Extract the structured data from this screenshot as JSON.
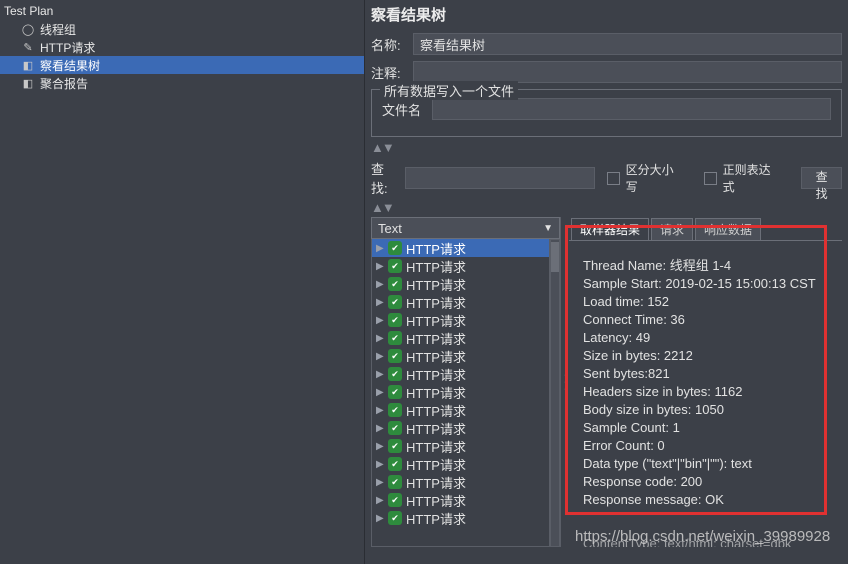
{
  "tree": {
    "root": "Test Plan",
    "items": [
      {
        "label": "线程组",
        "icon": "thread-group"
      },
      {
        "label": "HTTP请求",
        "icon": "sampler"
      },
      {
        "label": "察看结果树",
        "icon": "listener",
        "selected": true
      },
      {
        "label": "聚合报告",
        "icon": "listener"
      }
    ]
  },
  "panel": {
    "title": "察看结果树",
    "name_label": "名称:",
    "name_value": "察看结果树",
    "comment_label": "注释:",
    "fieldset_title": "所有数据写入一个文件",
    "file_label": "文件名"
  },
  "search": {
    "label": "查找:",
    "value": "",
    "case_label": "区分大小写",
    "regex_label": "正则表达式",
    "btn": "查找"
  },
  "render_dropdown": "Text",
  "tabs": [
    "取样器结果",
    "请求",
    "响应数据"
  ],
  "results": [
    "HTTP请求",
    "HTTP请求",
    "HTTP请求",
    "HTTP请求",
    "HTTP请求",
    "HTTP请求",
    "HTTP请求",
    "HTTP请求",
    "HTTP请求",
    "HTTP请求",
    "HTTP请求",
    "HTTP请求",
    "HTTP请求",
    "HTTP请求",
    "HTTP请求",
    "HTTP请求"
  ],
  "details": [
    "Thread Name: 线程组 1-4",
    "Sample Start: 2019-02-15 15:00:13 CST",
    "Load time: 152",
    "Connect Time: 36",
    "Latency: 49",
    "Size in bytes: 2212",
    "Sent bytes:821",
    "Headers size in bytes: 1162",
    "Body size in bytes: 1050",
    "Sample Count: 1",
    "Error Count: 0",
    "Data type (\"text\"|\"bin\"|\"\"): text",
    "Response code: 200",
    "Response message: OK"
  ],
  "extra_line": "ContentType: text/html; charset=gbk",
  "watermark": "https://blog.csdn.net/weixin_39989928"
}
